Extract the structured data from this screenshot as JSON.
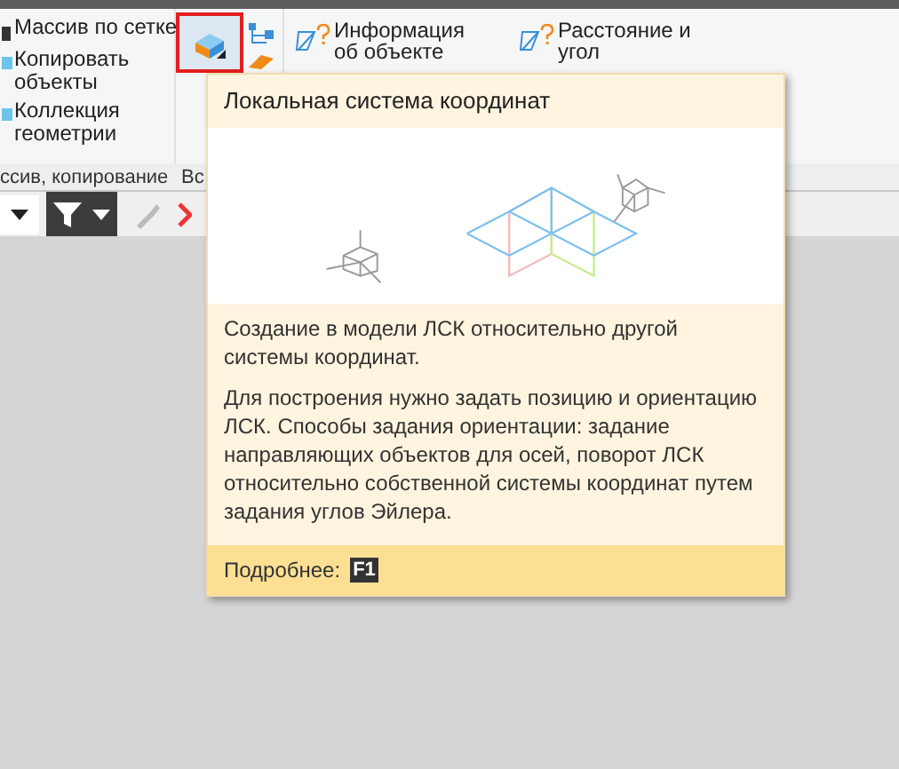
{
  "ribbon": {
    "groups": [
      {
        "label": "ссив, копирование",
        "commands": [
          {
            "label": "Массив по сетке"
          },
          {
            "label": "Копировать объекты"
          },
          {
            "label": "Коллекция геометрии"
          }
        ]
      },
      {
        "label": "Вс",
        "commands": [
          {
            "kind": "lcs",
            "highlighted": true
          }
        ]
      },
      {
        "commands": [
          {
            "label": "Информация об объекте"
          }
        ]
      },
      {
        "commands": [
          {
            "label": "Расстояние и угол"
          }
        ]
      }
    ]
  },
  "toolbar": {
    "filter": {
      "active": true
    }
  },
  "tooltip": {
    "title": "Локальная система координат",
    "paragraphs": [
      "Создание в модели ЛСК относительно другой системы координат.",
      "Для построения нужно задать позицию и ориентацию ЛСК. Способы задания ориентации: задание направляющих объектов для осей, поворот ЛСК относительно собственной системы координат путем задания углов Эйлера."
    ],
    "footer_label": "Подробнее:",
    "footer_key": "F1"
  }
}
